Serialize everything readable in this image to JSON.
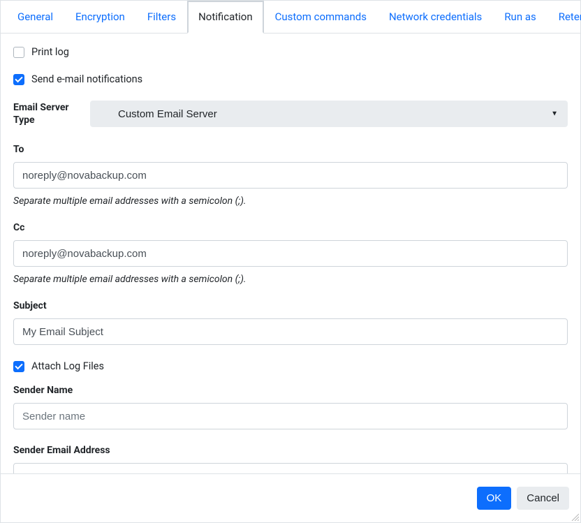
{
  "tabs": {
    "general": "General",
    "encryption": "Encryption",
    "filters": "Filters",
    "notification": "Notification",
    "custom_commands": "Custom commands",
    "network_credentials": "Network credentials",
    "run_as": "Run as",
    "retention": "Retention"
  },
  "form": {
    "print_log_label": "Print log",
    "send_email_label": "Send e-mail notifications",
    "email_server_type_label": "Email Server Type",
    "email_server_type_value": "Custom Email Server",
    "to_label": "To",
    "to_value": "noreply@novabackup.com",
    "to_hint": "Separate multiple email addresses with a semicolon (;).",
    "cc_label": "Cc",
    "cc_value": "noreply@novabackup.com",
    "cc_hint": "Separate multiple email addresses with a semicolon (;).",
    "subject_label": "Subject",
    "subject_value": "My Email Subject",
    "attach_log_label": "Attach Log Files",
    "sender_name_label": "Sender Name",
    "sender_name_placeholder": "Sender name",
    "sender_email_label": "Sender Email Address"
  },
  "footer": {
    "ok": "OK",
    "cancel": "Cancel"
  }
}
